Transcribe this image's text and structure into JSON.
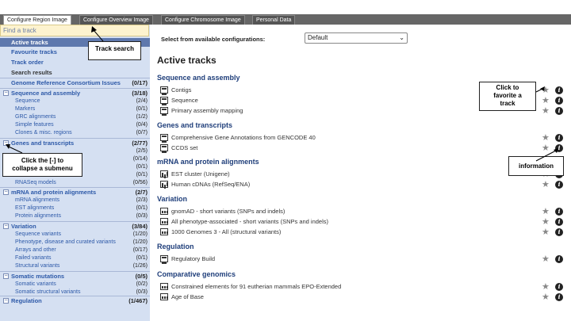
{
  "tabs": [
    "Configure Region Image",
    "Configure Overview Image",
    "Configure Chromosome Image",
    "Personal Data"
  ],
  "sidebar": {
    "find_placeholder": "Find a track",
    "items": [
      "Active tracks",
      "Favourite tracks",
      "Track order",
      "Search results"
    ],
    "grc": {
      "label": "Genome Reference Consortium Issues",
      "count": "(0/17)"
    },
    "groups": [
      {
        "label": "Sequence and assembly",
        "count": "(3/18)",
        "subs": [
          {
            "label": "Sequence",
            "count": "(2/4)"
          },
          {
            "label": "Markers",
            "count": "(0/1)"
          },
          {
            "label": "GRC alignments",
            "count": "(1/2)"
          },
          {
            "label": "Simple features",
            "count": "(0/4)"
          },
          {
            "label": "Clones & misc. regions",
            "count": "(0/7)"
          }
        ]
      },
      {
        "label": "Genes and transcripts",
        "count": "(2/77)",
        "subs": [
          {
            "label": "",
            "count": "(2/5)"
          },
          {
            "label": "",
            "count": "(0/14)"
          },
          {
            "label": "",
            "count": "(0/1)"
          },
          {
            "label": "",
            "count": "(0/1)"
          },
          {
            "label": "RNASeq models",
            "count": "(0/56)"
          }
        ]
      },
      {
        "label": "mRNA and protein alignments",
        "count": "(2/7)",
        "subs": [
          {
            "label": "mRNA alignments",
            "count": "(2/3)"
          },
          {
            "label": "EST alignments",
            "count": "(0/1)"
          },
          {
            "label": "Protein alignments",
            "count": "(0/3)"
          }
        ]
      },
      {
        "label": "Variation",
        "count": "(3/84)",
        "subs": [
          {
            "label": "Sequence variants",
            "count": "(1/20)"
          },
          {
            "label": "Phenotype, disease and curated variants",
            "count": "(1/20)"
          },
          {
            "label": "Arrays and other",
            "count": "(0/17)"
          },
          {
            "label": "Failed variants",
            "count": "(0/1)"
          },
          {
            "label": "Structural variants",
            "count": "(1/26)"
          }
        ]
      },
      {
        "label": "Somatic mutations",
        "count": "(0/5)",
        "subs": [
          {
            "label": "Somatic variants",
            "count": "(0/2)"
          },
          {
            "label": "Somatic structural variants",
            "count": "(0/3)"
          }
        ]
      },
      {
        "label": "Regulation",
        "count": "(1/467)",
        "subs": []
      }
    ]
  },
  "main": {
    "select_label": "Select from available configurations:",
    "select_value": "Default",
    "heading": "Active tracks",
    "sections": [
      {
        "title": "Sequence and assembly",
        "tracks": [
          {
            "name": "Contigs",
            "icon": "dna"
          },
          {
            "name": "Sequence",
            "icon": "dna"
          },
          {
            "name": "Primary assembly mapping",
            "icon": "dna"
          }
        ]
      },
      {
        "title": "Genes and transcripts",
        "tracks": [
          {
            "name": "Comprehensive Gene Annotations from GENCODE 40",
            "icon": "dna"
          },
          {
            "name": "CCDS set",
            "icon": "dna"
          }
        ]
      },
      {
        "title": "mRNA and protein alignments",
        "tracks": [
          {
            "name": "EST cluster (Unigene)",
            "icon": "bars"
          },
          {
            "name": "Human cDNAs (RefSeq/ENA)",
            "icon": "bars"
          }
        ]
      },
      {
        "title": "Variation",
        "tracks": [
          {
            "name": "gnomAD - short variants (SNPs and indels)",
            "icon": "dots"
          },
          {
            "name": "All phenotype-associated - short variants (SNPs and indels)",
            "icon": "dots"
          },
          {
            "name": "1000 Genomes 3 - All (structural variants)",
            "icon": "dots"
          }
        ]
      },
      {
        "title": "Regulation",
        "tracks": [
          {
            "name": "Regulatory Build",
            "icon": "dna"
          }
        ]
      },
      {
        "title": "Comparative genomics",
        "tracks": [
          {
            "name": "Constrained elements for 91 eutherian mammals EPO-Extended",
            "icon": "dots"
          },
          {
            "name": "Age of Base",
            "icon": "dots"
          }
        ]
      }
    ]
  },
  "callouts": {
    "track_search": "Track search",
    "collapse_line1": "Click the [-] to",
    "collapse_line2": "collapse a submenu",
    "favorite_line1": "Click to",
    "favorite_line2": "favorite a",
    "favorite_line3": "track",
    "information": "information"
  },
  "icons": {
    "star": "star-icon",
    "info": "info-icon",
    "collapse": "collapse-toggle-icon"
  },
  "colors": {
    "sidebar_bg": "#d5e0f2",
    "sidebar_selected": "#5e78ad",
    "link": "#2d59a8",
    "section_title": "#1f3e7a",
    "search_bg": "#fdf3cf"
  }
}
